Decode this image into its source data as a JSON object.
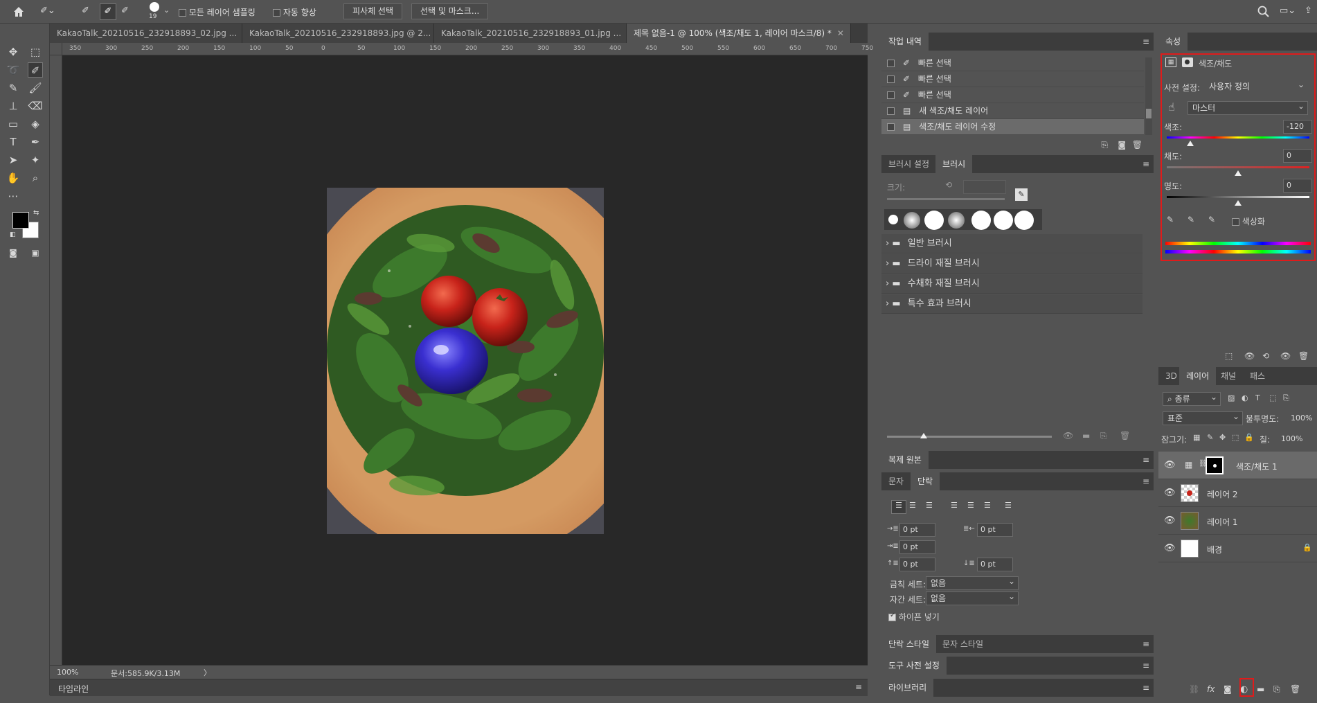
{
  "optionsbar": {
    "brush_size": "19",
    "sample_all_layers": "모든 레이어 샘플링",
    "auto_enhance": "자동 향상",
    "select_subject": "피사체 선택",
    "select_and_mask": "선택 및 마스크..."
  },
  "tabs": [
    {
      "label": "KakaoTalk_20210516_232918893_02.jpg ..."
    },
    {
      "label": "KakaoTalk_20210516_232918893.jpg @ 2..."
    },
    {
      "label": "KakaoTalk_20210516_232918893_01.jpg ..."
    },
    {
      "label": "제목 없음-1 @ 100% (색조/채도 1, 레이어 마스크/8) *"
    }
  ],
  "ruler": {
    "h_ticks": [
      "350",
      "300",
      "250",
      "200",
      "150",
      "100",
      "50",
      "0",
      "50",
      "100",
      "150",
      "200",
      "250",
      "300",
      "350",
      "400",
      "450",
      "500",
      "550",
      "600",
      "650",
      "700",
      "750"
    ]
  },
  "status": {
    "zoom": "100%",
    "doc": "문서:585.9K/3.13M",
    "arrow": "〉"
  },
  "timeline": {
    "label": "타임라인"
  },
  "history": {
    "title": "작업 내역",
    "items": [
      {
        "label": "빠른 선택"
      },
      {
        "label": "빠른 선택"
      },
      {
        "label": "빠른 선택"
      },
      {
        "label": "새 색조/채도 레이어"
      },
      {
        "label": "색조/채도 레이어 수정"
      }
    ]
  },
  "brush": {
    "tab_settings": "브러시 설정",
    "tab_brush": "브러시",
    "size_label": "크기:",
    "folders": [
      {
        "label": "일반 브러시"
      },
      {
        "label": "드라이 재질 브러시"
      },
      {
        "label": "수채화 재질 브러시"
      },
      {
        "label": "특수 효과 브러시"
      }
    ]
  },
  "clone_source": {
    "title": "복제 원본"
  },
  "paragraph": {
    "tab_char": "문자",
    "tab_para": "단락",
    "indent_left": "0 pt",
    "indent_right": "0 pt",
    "indent_first": "0 pt",
    "space_before": "0 pt",
    "space_after": "0 pt",
    "kinsoku_label": "금칙 세트:",
    "kinsoku_value": "없음",
    "mojikumi_label": "자간 세트:",
    "mojikumi_value": "없음",
    "hyphenate": "하이픈 넣기"
  },
  "styles": {
    "tab_para_style": "단락 스타일",
    "tab_char_style": "문자 스타일"
  },
  "tool_presets": {
    "title": "도구 사전 설정"
  },
  "library": {
    "title": "라이브러리"
  },
  "properties": {
    "title": "속성",
    "adj_name": "색조/채도",
    "preset_label": "사전 설정:",
    "preset_value": "사용자 정의",
    "channel_value": "마스터",
    "hue_label": "색조:",
    "hue_value": "-120",
    "hue_pos": 0.167,
    "sat_label": "채도:",
    "sat_value": "0",
    "sat_pos": 0.5,
    "light_label": "명도:",
    "light_value": "0",
    "light_pos": 0.5,
    "colorize_label": "색상화"
  },
  "layers": {
    "tab_3d": "3D",
    "tab_layers": "레이어",
    "tab_channels": "채널",
    "tab_paths": "패스",
    "filter_label": "종류",
    "blend_mode": "표준",
    "opacity_label": "불투명도:",
    "opacity_value": "100%",
    "lock_label": "잠그기:",
    "fill_label": "칠:",
    "fill_value": "100%",
    "items": [
      {
        "name": "색조/채도 1"
      },
      {
        "name": "레이어 2"
      },
      {
        "name": "레이어 1"
      },
      {
        "name": "배경"
      }
    ]
  },
  "colors": {
    "highlight_red": "#e01b1b",
    "blue_tomato": "#3a2fd0",
    "tomato_red": "#c8231a"
  }
}
